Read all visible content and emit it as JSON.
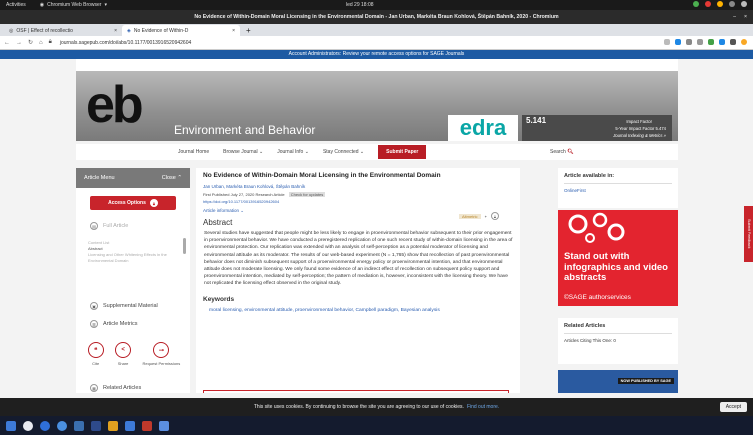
{
  "os": {
    "activities": "Activities",
    "browser": "Chromium Web Browser",
    "clock": "led 29  18:08"
  },
  "window": {
    "title": "No Evidence of Within-Domain Moral Licensing in the Environmental Domain - Jan Urban, Markéta Braun Kohlová, Štěpán Bahník, 2020 - Chromium"
  },
  "tabs": [
    {
      "label": "OSF | Effect of recollectio"
    },
    {
      "label": "No Evidence of Within-D"
    }
  ],
  "address": {
    "url": "journals.sagepub.com/doi/abs/10.1177/0013916520942604"
  },
  "banner": {
    "text": "Account Administrators: Review your remote access options for SAGE Journals"
  },
  "journal": {
    "logo": "eb",
    "title": "Environment and Behavior",
    "publisher": "edra",
    "impact_value": "5.141",
    "impact_label": "Impact Factor",
    "impact_5yr": "5-Year Impact Factor 5.474",
    "impact_link": "Journal Indexing & Metrics »"
  },
  "nav": {
    "home": "Journal Home",
    "browse": "Browse Journal",
    "info": "Journal Info",
    "connected": "Stay Connected",
    "submit": "Submit Paper",
    "search": "Search"
  },
  "sidebar": {
    "menu_label": "Article Menu",
    "close_label": "Close",
    "access_options": "Access Options",
    "full_article": "Full Article",
    "content_list": "Content List",
    "cl_abstract": "Abstract",
    "cl_item": "Licensing and Other Whitening Effects in the Environmental Domain",
    "supplemental": "Supplemental Material",
    "metrics": "Article Metrics",
    "cite": "Cite",
    "share": "Share",
    "request": "Request Permissions",
    "related_articles": "Related Articles"
  },
  "article": {
    "title": "No Evidence of Within-Domain Moral Licensing in the Environmental Domain",
    "authors": "Jan Urban, Markéta Braun Kohlová, Štěpán Bahník",
    "meta": "First Published July 27, 2020   Research Article",
    "update_tag": "Check for updates",
    "doi": "https://doi.org/10.1177/0013916520942604",
    "info": "Article information",
    "altmetric": "Altmetric",
    "abstract_heading": "Abstract",
    "abstract_text": "Several studies have suggested that people might be less likely to engage in proenvironmental behavior subsequent to their prior engagement in proenvironmental behavior. We have conducted a preregistered replication of one such recent study of within-domain licensing in the area of environmental protection. Our replication was extended with an analysis of self-perception as a potential moderator of licensing and environmental attitude as its moderator. The results of our web-based experiment (N = 1,765) show that recollection of past proenvironmental behavior does not diminish subsequent support of a proenvironmental energy policy or proenvironmental intention, and that environmental attitude does not moderate licensing. We only found some evidence of an indirect effect of recollection on subsequent policy support and proenvironmental intention, mediated by self-perception; the pattern of mediation is, however, inconsistent with the licensing theory. We have not replicated the licensing effect observed in the original study.",
    "keywords_heading": "Keywords",
    "keywords": "moral licensing,  environmental attitude,  proenvironmental behavior,  Campbell paradigm,  Bayesian analysis"
  },
  "right": {
    "available_heading": "Article available in:",
    "online_first": "OnlineFirst",
    "ad_text": "Stand out with infographics and video abstracts",
    "ad_footer": "©SAGE authorservices",
    "related_heading": "Related Articles",
    "citing": "Articles Citing This One: 0",
    "promo_tag": "NOW PUBLISHED BY SAGE",
    "feedback": "Submit Feedback"
  },
  "cookie": {
    "text": "This site uses cookies. By continuing to browse the site you are agreeing to our use of cookies.",
    "learn_more": "Find out more.",
    "accept": "Accept"
  }
}
